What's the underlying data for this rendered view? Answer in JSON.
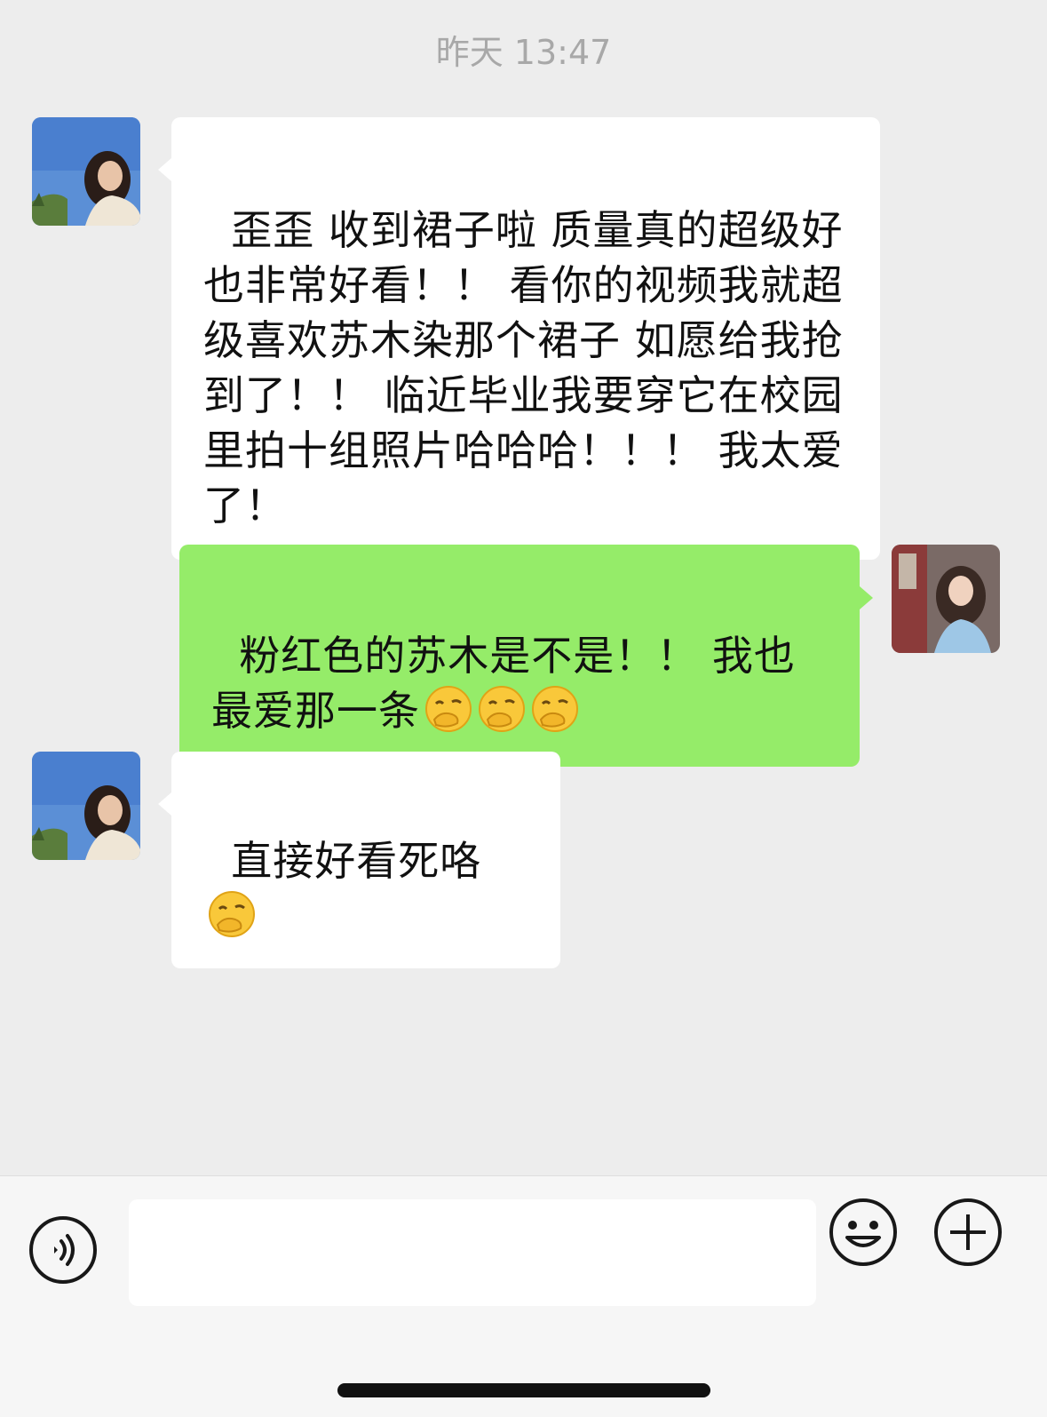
{
  "timestamp": "昨天 13:47",
  "messages": [
    {
      "side": "left",
      "text": "歪歪 收到裙子啦 质量真的超级好 也非常好看！！ 看你的视频我就超级喜欢苏木染那个裙子 如愿给我抢到了！！ 临近毕业我要穿它在校园里拍十组照片哈哈哈！！！ 我太爱了！"
    },
    {
      "side": "right",
      "text": "粉红色的苏木是不是！！ 我也最爱那一条",
      "emoji_count": 3
    },
    {
      "side": "left",
      "text": "直接好看死咯",
      "emoji_count": 1
    }
  ],
  "emoji_icon": "hand-over-mouth-face-icon",
  "input_bar": {
    "voice_icon": "voice-icon",
    "emoji_icon": "smiley-icon",
    "plus_icon": "plus-icon",
    "input_value": ""
  },
  "colors": {
    "background": "#ededed",
    "incoming_bubble": "#ffffff",
    "outgoing_bubble": "#95ec69",
    "timestamp": "#a8a8a8"
  }
}
